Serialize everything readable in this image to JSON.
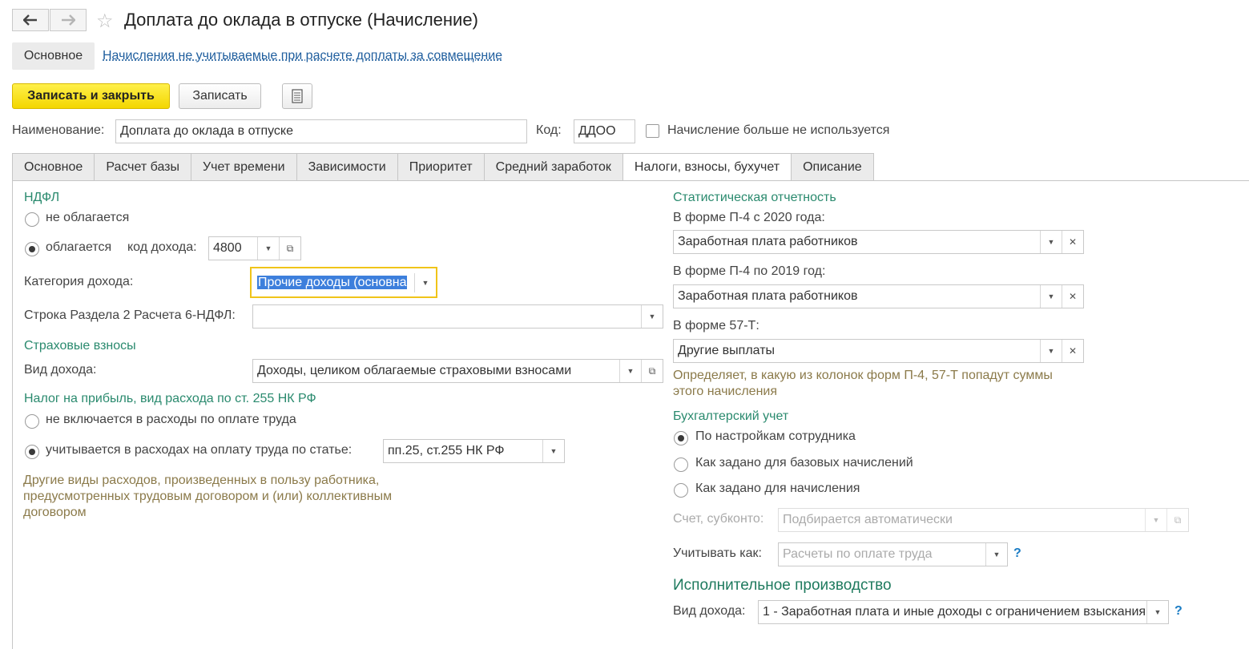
{
  "window": {
    "title": "Доплата до оклада в отпуске (Начисление)"
  },
  "nav": {
    "main_pill": "Основное",
    "link": "Начисления не учитываемые при расчете доплаты за совмещение"
  },
  "toolbar": {
    "save_close": "Записать и закрыть",
    "save": "Записать"
  },
  "header": {
    "name_label": "Наименование:",
    "name_value": "Доплата до оклада в отпуске",
    "code_label": "Код:",
    "code_value": "ДДОО",
    "not_used_label": "Начисление больше не используется"
  },
  "tabs": [
    "Основное",
    "Расчет базы",
    "Учет времени",
    "Зависимости",
    "Приоритет",
    "Средний заработок",
    "Налоги, взносы, бухучет",
    "Описание"
  ],
  "left": {
    "ndfl_title": "НДФЛ",
    "not_taxed": "не облагается",
    "taxed": "облагается",
    "income_code_label": "код дохода:",
    "income_code_value": "4800",
    "income_category_label": "Категория дохода:",
    "income_category_value": "Прочие доходы (основна",
    "row6_label": "Строка Раздела 2 Расчета 6-НДФЛ:",
    "row6_value": "",
    "insurance_title": "Страховые взносы",
    "income_kind_label": "Вид дохода:",
    "income_kind_value": "Доходы, целиком облагаемые страховыми взносами",
    "profit_tax_title": "Налог на прибыль, вид расхода по ст. 255 НК РФ",
    "not_included": "не включается в расходы по оплате труда",
    "included_by_article": "учитывается в расходах на оплату труда по статье:",
    "article_value": "пп.25, ст.255 НК РФ",
    "article_hint_1": "Другие виды расходов, произведенных в пользу работника,",
    "article_hint_2": "предусмотренных трудовым договором и (или) коллективным",
    "article_hint_3": "договором"
  },
  "right": {
    "stat_title": "Статистическая отчетность",
    "p4_2020_label": "В форме П-4 с 2020 года:",
    "p4_2020_value": "Заработная плата работников",
    "p4_2019_label": "В форме П-4 по 2019 год:",
    "p4_2019_value": "Заработная плата работников",
    "f57_label": "В форме 57-Т:",
    "f57_value": "Другие выплаты",
    "stat_hint_1": "Определяет, в какую из колонок форм П-4, 57-Т попадут суммы",
    "stat_hint_2": "этого начисления",
    "acc_title": "Бухгалтерский учет",
    "acc_opt1": "По настройкам сотрудника",
    "acc_opt2": "Как задано для базовых начислений",
    "acc_opt3": "Как задано для начисления",
    "account_label": "Счет, субконто:",
    "account_placeholder": "Подбирается автоматически",
    "account_as_label": "Учитывать как:",
    "account_as_placeholder": "Расчеты по оплате труда",
    "enforcement_title": "Исполнительное производство",
    "enforcement_income_label": "Вид дохода:",
    "enforcement_income_value": "1 - Заработная плата и иные доходы с ограничением взыскания"
  },
  "colors": {
    "section_green": "#2a8a6e",
    "hint_brown": "#8b7a4a",
    "link_blue": "#1f5e9e",
    "primary_yellow": "#f3d600",
    "focus_border": "#f0c419"
  }
}
